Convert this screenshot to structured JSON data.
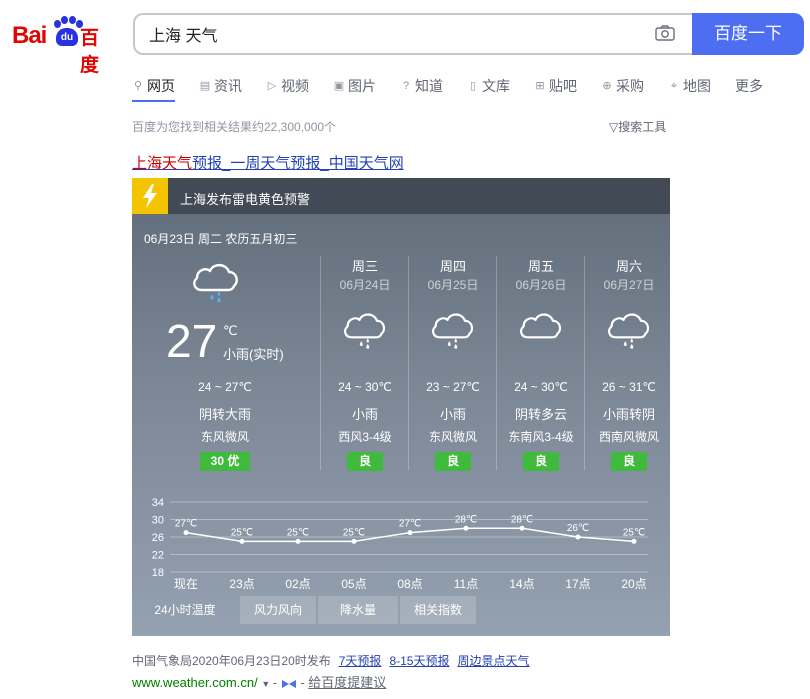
{
  "logo": {
    "bai": "Bai",
    "du": "du",
    "cn": "百度"
  },
  "search": {
    "value": "上海 天气",
    "button": "百度一下"
  },
  "tabs": [
    {
      "label": "网页",
      "icon": "search-icon",
      "glyph": "⚲"
    },
    {
      "label": "资讯",
      "icon": "news-icon",
      "glyph": "▤"
    },
    {
      "label": "视频",
      "icon": "video-icon",
      "glyph": "▷"
    },
    {
      "label": "图片",
      "icon": "image-icon",
      "glyph": "▣"
    },
    {
      "label": "知道",
      "icon": "question-icon",
      "glyph": "?"
    },
    {
      "label": "文库",
      "icon": "doc-icon",
      "glyph": "▯"
    },
    {
      "label": "贴吧",
      "icon": "tieba-icon",
      "glyph": "⊞"
    },
    {
      "label": "采购",
      "icon": "cart-icon",
      "glyph": "⊕"
    },
    {
      "label": "地图",
      "icon": "map-pin-icon",
      "glyph": "⌖"
    },
    {
      "label": "更多",
      "icon": "",
      "glyph": ""
    }
  ],
  "result_count": "百度为您找到相关结果约22,300,000个",
  "search_tools": "搜索工具",
  "result": {
    "title_hl": "上海天气",
    "title_rest": "预报_一周天气预报_中国天气网"
  },
  "weather": {
    "alert": "上海发布雷电黄色预警",
    "today": {
      "date": "06月23日 周二 农历五月初三",
      "temp": "27",
      "unit": "℃",
      "now_cond": "小雨(实时)",
      "range": "24 ~ 27℃",
      "cond": "阴转大雨",
      "wind": "东风微风",
      "aqi": "30  优"
    },
    "days": [
      {
        "name": "周三",
        "date": "06月24日",
        "range": "24 ~ 30℃",
        "cond": "小雨",
        "wind": "西风3-4级",
        "aqi": "良",
        "icon": "rain-cloud-icon"
      },
      {
        "name": "周四",
        "date": "06月25日",
        "range": "23 ~ 27℃",
        "cond": "小雨",
        "wind": "东风微风",
        "aqi": "良",
        "icon": "rain-cloud-icon"
      },
      {
        "name": "周五",
        "date": "06月26日",
        "range": "24 ~ 30℃",
        "cond": "阴转多云",
        "wind": "东南风3-4级",
        "aqi": "良",
        "icon": "cloud-icon"
      },
      {
        "name": "周六",
        "date": "06月27日",
        "range": "26 ~ 31℃",
        "cond": "小雨转阴",
        "wind": "西南风微风",
        "aqi": "良",
        "icon": "rain-cloud-icon"
      }
    ],
    "chart_tabs": [
      "24小时温度",
      "风力风向",
      "降水量",
      "相关指数"
    ]
  },
  "chart_data": {
    "type": "line",
    "categories": [
      "现在",
      "23点",
      "02点",
      "05点",
      "08点",
      "11点",
      "14点",
      "17点",
      "20点"
    ],
    "values": [
      27,
      25,
      25,
      25,
      27,
      28,
      28,
      26,
      25
    ],
    "point_labels": [
      "27℃",
      "25℃",
      "25℃",
      "25℃",
      "27℃",
      "28℃",
      "28℃",
      "26℃",
      "25℃"
    ],
    "y_ticks": [
      "34",
      "30",
      "26",
      "22",
      "18"
    ],
    "ylim": [
      18,
      34
    ],
    "grid": true
  },
  "footer": {
    "source": "中国气象局2020年06月23日20时发布",
    "links": [
      "7天预报",
      "8-15天预报",
      "周边景点天气"
    ],
    "url": "www.weather.com.cn/",
    "feedback": "给百度提建议"
  },
  "colors": {
    "accent": "#4e6ef2",
    "logo_red": "#e10602",
    "logo_blue": "#2932e1",
    "aqi_green": "#3fba3c",
    "alert_yellow": "#f5c400",
    "link": "#2440b3"
  }
}
